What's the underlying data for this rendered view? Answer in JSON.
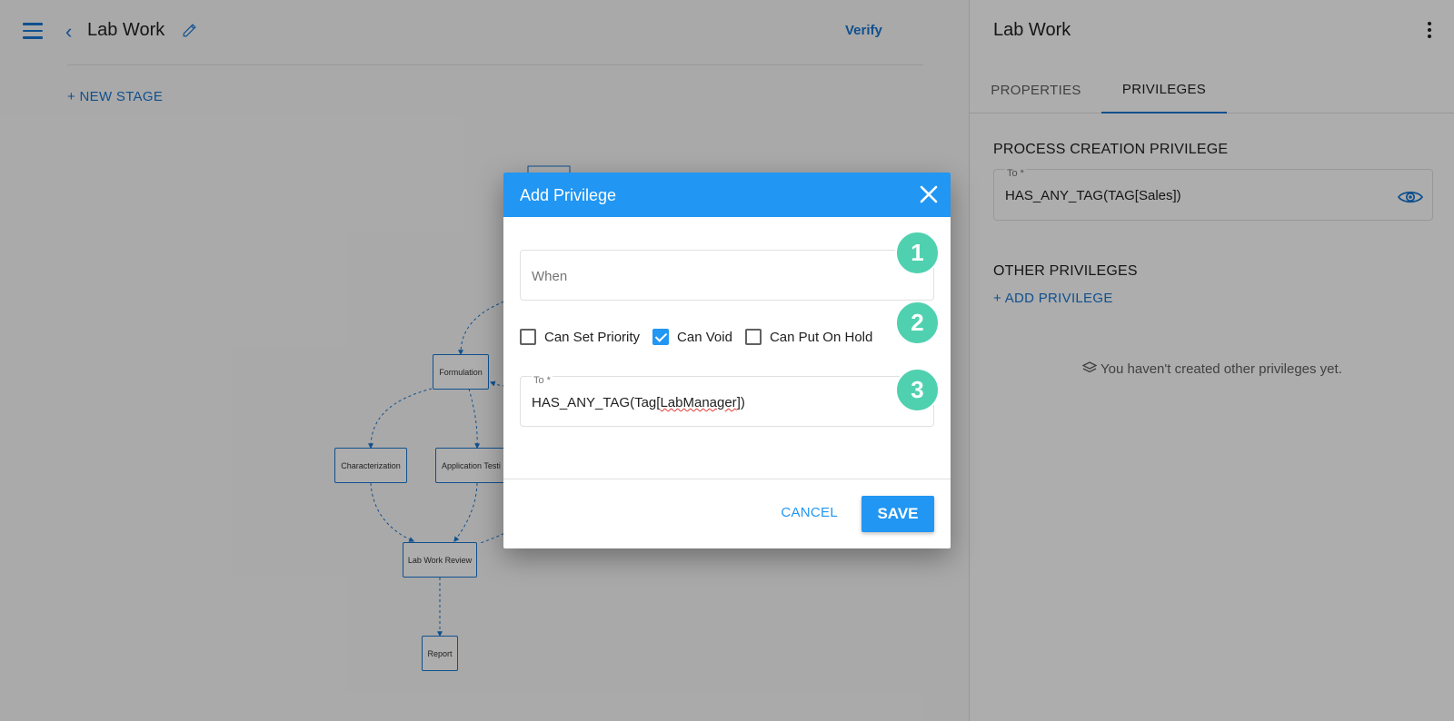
{
  "header": {
    "title": "Lab Work",
    "verify_label": "Verify",
    "new_stage_label": "NEW STAGE"
  },
  "flow": {
    "nodes": [
      {
        "id": "formulation",
        "label": "Formulation"
      },
      {
        "id": "characterization",
        "label": "Characterization"
      },
      {
        "id": "application-testing",
        "label": "Application Testi"
      },
      {
        "id": "lab-work-review",
        "label": "Lab Work Review"
      },
      {
        "id": "report",
        "label": "Report"
      }
    ]
  },
  "panel": {
    "title": "Lab Work",
    "tabs": [
      {
        "label": "PROPERTIES",
        "active": false
      },
      {
        "label": "PRIVILEGES",
        "active": true
      }
    ],
    "process_creation": {
      "heading": "PROCESS CREATION PRIVILEGE",
      "to_label": "To *",
      "to_value": "HAS_ANY_TAG(TAG[Sales])"
    },
    "other": {
      "heading": "OTHER PRIVILEGES",
      "add_label": "ADD PRIVILEGE",
      "empty_message": "You haven't created other privileges yet."
    }
  },
  "dialog": {
    "title": "Add Privilege",
    "when_placeholder": "When",
    "checkboxes": [
      {
        "label": "Can Set Priority",
        "checked": false
      },
      {
        "label": "Can Void",
        "checked": true
      },
      {
        "label": "Can Put On Hold",
        "checked": false
      }
    ],
    "to_label": "To *",
    "to_value_prefix": "HAS_ANY_TAG(Tag[",
    "to_value_highlight": "LabManager",
    "to_value_suffix": "])",
    "cancel_label": "CANCEL",
    "save_label": "SAVE",
    "badges": [
      "1",
      "2",
      "3"
    ]
  },
  "colors": {
    "accent": "#1976d2",
    "dialog_header": "#2196f3",
    "badge": "#4fd1b0"
  },
  "icons": [
    "menu-icon",
    "back-chevron-icon",
    "pencil-icon",
    "kebab-icon",
    "eye-icon",
    "close-icon",
    "plus-icon",
    "layers-icon"
  ]
}
